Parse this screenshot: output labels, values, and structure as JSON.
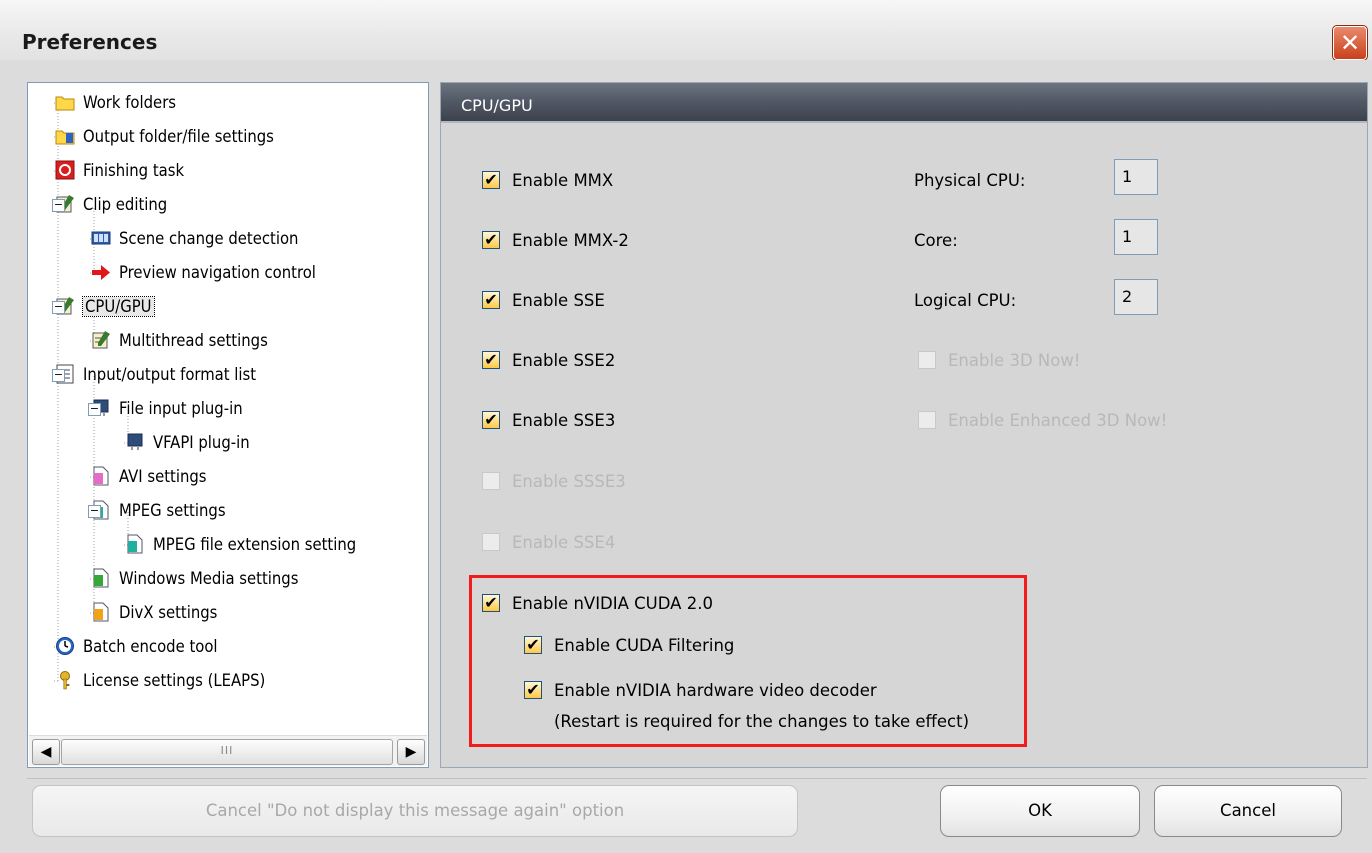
{
  "window": {
    "title": "Preferences",
    "close_glyph": "✕"
  },
  "tree": {
    "items": [
      {
        "label": "Work folders",
        "icon": "folder-icon"
      },
      {
        "label": "Output folder/file settings",
        "icon": "output-folder-icon"
      },
      {
        "label": "Finishing task",
        "icon": "finishing-task-icon"
      },
      {
        "label": "Clip editing",
        "icon": "clip-editing-icon"
      },
      {
        "label": "Scene change detection",
        "icon": "filmstrip-icon"
      },
      {
        "label": "Preview navigation control",
        "icon": "red-arrow-icon"
      },
      {
        "label": "CPU/GPU",
        "icon": "cpu-gpu-icon",
        "selected": true
      },
      {
        "label": "Multithread settings",
        "icon": "multithread-icon"
      },
      {
        "label": "Input/output format list",
        "icon": "format-list-icon"
      },
      {
        "label": "File input plug-in",
        "icon": "plugin-icon"
      },
      {
        "label": "VFAPI plug-in",
        "icon": "plugin-icon"
      },
      {
        "label": "AVI settings",
        "icon": "avi-file-icon"
      },
      {
        "label": "MPEG settings",
        "icon": "mpeg-file-icon"
      },
      {
        "label": "MPEG file extension setting",
        "icon": "mpeg-file-icon"
      },
      {
        "label": "Windows Media settings",
        "icon": "wm-file-icon"
      },
      {
        "label": "DivX settings",
        "icon": "divx-file-icon"
      },
      {
        "label": "Batch encode tool",
        "icon": "clock-icon"
      },
      {
        "label": "License settings (LEAPS)",
        "icon": "key-icon"
      }
    ],
    "scroll_thumb_grip": "III"
  },
  "panel": {
    "title": "CPU/GPU",
    "options_left": [
      {
        "label": "Enable MMX",
        "checked": true,
        "enabled": true
      },
      {
        "label": "Enable MMX-2",
        "checked": true,
        "enabled": true
      },
      {
        "label": "Enable SSE",
        "checked": true,
        "enabled": true
      },
      {
        "label": "Enable SSE2",
        "checked": true,
        "enabled": true
      },
      {
        "label": "Enable SSE3",
        "checked": true,
        "enabled": true
      },
      {
        "label": "Enable SSSE3",
        "checked": false,
        "enabled": false
      },
      {
        "label": "Enable SSE4",
        "checked": false,
        "enabled": false
      }
    ],
    "cpu_info": [
      {
        "label": "Physical CPU:",
        "value": "1"
      },
      {
        "label": "Core:",
        "value": "1"
      },
      {
        "label": "Logical CPU:",
        "value": "2"
      }
    ],
    "options_right": [
      {
        "label": "Enable 3D Now!",
        "checked": false,
        "enabled": false
      },
      {
        "label": "Enable Enhanced 3D Now!",
        "checked": false,
        "enabled": false
      }
    ],
    "cuda": {
      "main": {
        "label": "Enable nVIDIA CUDA 2.0",
        "checked": true
      },
      "filtering": {
        "label": "Enable CUDA Filtering",
        "checked": true
      },
      "decoder": {
        "label": "Enable nVIDIA hardware video decoder",
        "checked": true
      },
      "note": "(Restart is required for the changes to take effect)",
      "highlight_color": "#f21b1b"
    }
  },
  "buttons": {
    "cancel_msg": "Cancel \"Do not display this message again\" option",
    "ok": "OK",
    "cancel": "Cancel"
  },
  "check_glyph": "✔"
}
